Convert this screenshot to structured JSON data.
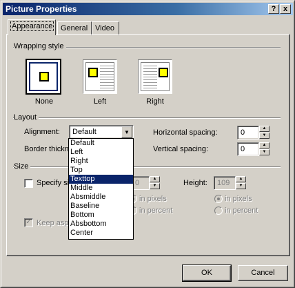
{
  "window": {
    "title": "Picture Properties",
    "help_button": "?",
    "close_button": "x"
  },
  "tabs": [
    {
      "label": "Appearance",
      "active": true
    },
    {
      "label": "General",
      "active": false
    },
    {
      "label": "Video",
      "active": false
    }
  ],
  "wrapping": {
    "group_label": "Wrapping style",
    "options": [
      {
        "label": "None",
        "selected": true
      },
      {
        "label": "Left",
        "selected": false
      },
      {
        "label": "Right",
        "selected": false
      }
    ]
  },
  "layout": {
    "group_label": "Layout",
    "alignment_label": "Alignment:",
    "alignment_value": "Default",
    "border_label": "Border thickne",
    "horizontal_label": "Horizontal spacing:",
    "horizontal_value": "0",
    "vertical_label": "Vertical spacing:",
    "vertical_value": "0"
  },
  "alignment_dropdown": {
    "options": [
      "Default",
      "Left",
      "Right",
      "Top",
      "Texttop",
      "Middle",
      "Absmiddle",
      "Baseline",
      "Bottom",
      "Absbottom",
      "Center"
    ],
    "highlighted": "Texttop"
  },
  "size": {
    "group_label": "Size",
    "specify_label": "Specify siz",
    "width_value": "0",
    "height_label": "Height:",
    "height_value": "109",
    "width_pixels_label": "in pixels",
    "width_percent_label": "in percent",
    "height_pixels_label": "in pixels",
    "height_percent_label": "in percent",
    "keep_aspect_label": "Keep aspe"
  },
  "buttons": {
    "ok": "OK",
    "cancel": "Cancel"
  },
  "colors": {
    "dialog_bg": "#d4d0c8",
    "title_bar": "#0a246a",
    "highlight": "#0a246a",
    "picture_fill": "#ffff00"
  }
}
